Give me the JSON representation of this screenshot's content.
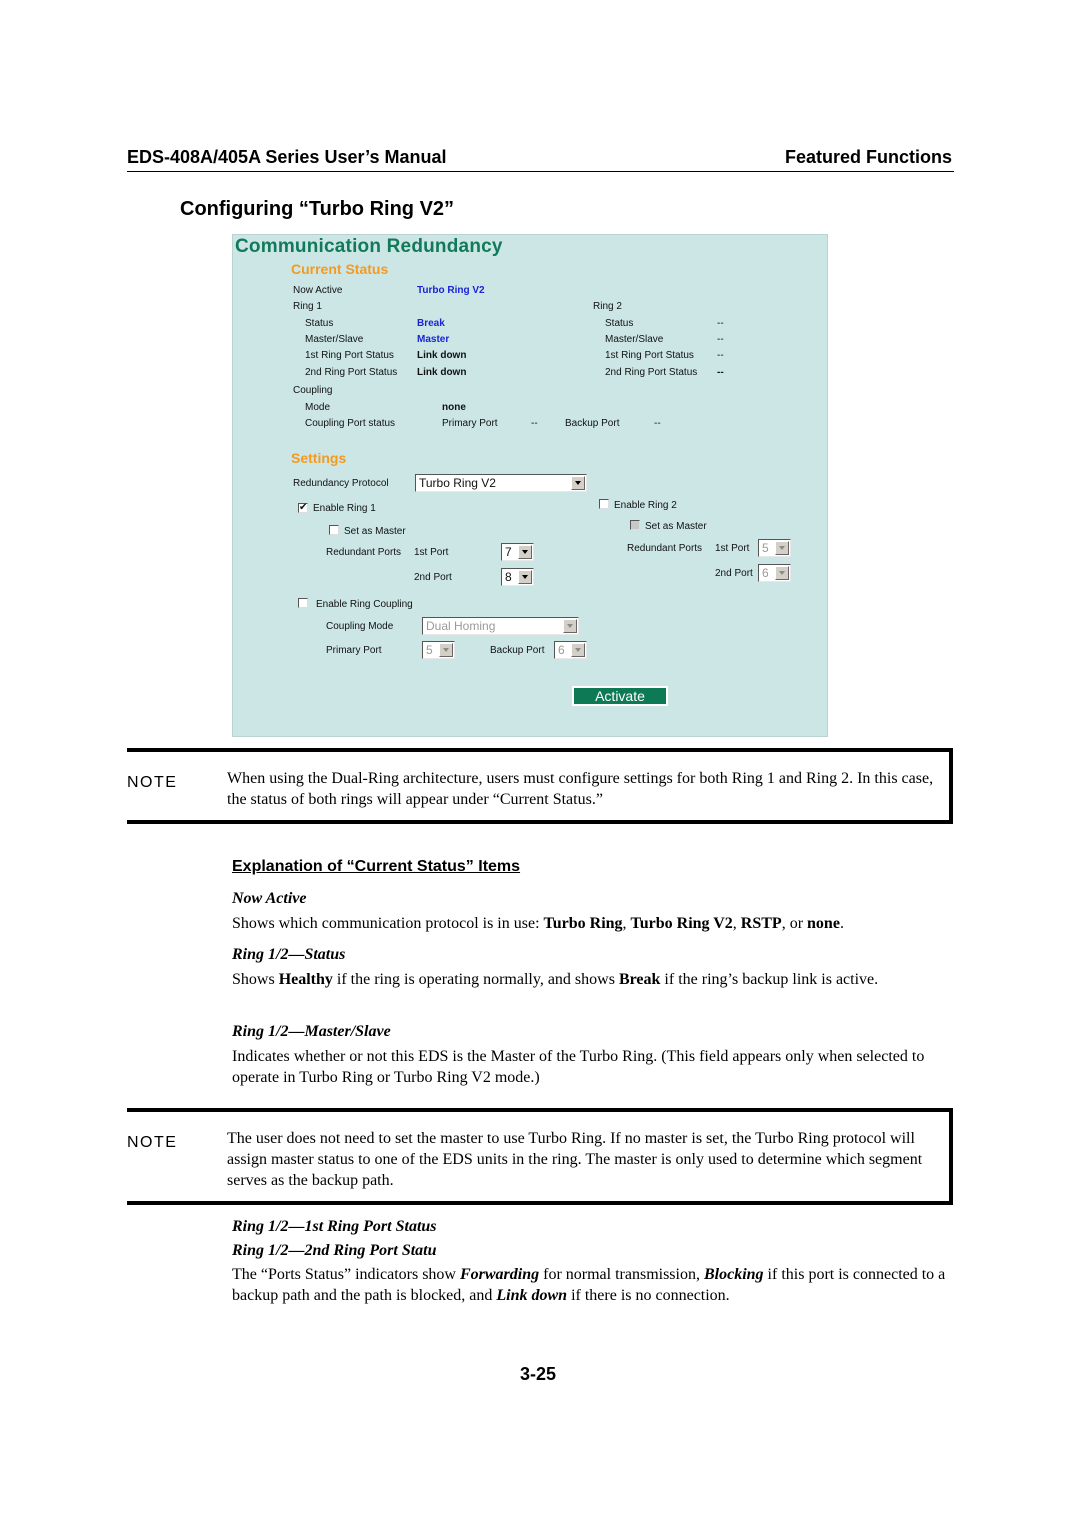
{
  "header": {
    "manual_title": "EDS-408A/405A Series User’s Manual",
    "chapter": "Featured Functions"
  },
  "section_title": "Configuring “Turbo Ring V2”",
  "panel": {
    "title": "Communication Redundancy",
    "current_status": {
      "heading": "Current Status",
      "now_active_label": "Now Active",
      "now_active_value": "Turbo Ring V2",
      "ring1": {
        "label": "Ring 1",
        "status_label": "Status",
        "status_value": "Break",
        "master_label": "Master/Slave",
        "master_value": "Master",
        "port1_label": "1st Ring Port Status",
        "port1_value": "Link down",
        "port2_label": "2nd Ring Port Status",
        "port2_value": "Link down"
      },
      "ring2": {
        "label": "Ring 2",
        "status_label": "Status",
        "status_value": "--",
        "master_label": "Master/Slave",
        "master_value": "--",
        "port1_label": "1st Ring Port Status",
        "port1_value": "--",
        "port2_label": "2nd Ring Port Status",
        "port2_value": "--"
      },
      "coupling": {
        "label": "Coupling",
        "mode_label": "Mode",
        "mode_value": "none",
        "port_status_label": "Coupling Port status",
        "primary_label": "Primary Port",
        "primary_value": "--",
        "backup_label": "Backup Port",
        "backup_value": "--"
      }
    },
    "settings": {
      "heading": "Settings",
      "protocol_label": "Redundancy Protocol",
      "protocol_value": "Turbo Ring V2",
      "ring1": {
        "enable_label": "Enable Ring 1",
        "enable_checked": "✔",
        "master_label": "Set as Master",
        "ports_label": "Redundant Ports",
        "port1_label": "1st Port",
        "port1_value": "7",
        "port2_label": "2nd Port",
        "port2_value": "8"
      },
      "ring2": {
        "enable_label": "Enable Ring 2",
        "master_label": "Set as Master",
        "ports_label": "Redundant Ports",
        "port1_label": "1st Port",
        "port1_value": "5",
        "port2_label": "2nd Port",
        "port2_value": "6"
      },
      "coupling": {
        "enable_label": "Enable Ring Coupling",
        "mode_label": "Coupling Mode",
        "mode_value": "Dual Homing",
        "primary_label": "Primary Port",
        "primary_value": "5",
        "backup_label": "Backup Port",
        "backup_value": "6"
      },
      "activate_label": "Activate"
    },
    "colors": {
      "background": "#cce6e6",
      "title": "#127a5a",
      "subheading": "#f59a1f",
      "value_blue": "#1a24d6",
      "button": "#0d7a55"
    }
  },
  "notes": [
    {
      "label": "NOTE",
      "text": "When using the Dual-Ring architecture, users must configure settings for both Ring 1 and Ring 2. In this case, the status of both rings will appear under “Current Status.”"
    },
    {
      "label": "NOTE",
      "text": "The user does not need to set the master to use Turbo Ring. If no master is set, the Turbo Ring protocol will assign master status to one of the EDS units in the ring. The master is only used to determine which segment serves as the backup path."
    }
  ],
  "explanation": {
    "heading": "Explanation of “Current Status” Items",
    "now_active": {
      "title": "Now Active",
      "t1": "Shows which communication protocol is in use: ",
      "b1": "Turbo Ring",
      "t2": ", ",
      "b2": "Turbo Ring V2",
      "t3": ", ",
      "b3": "RSTP",
      "t4": ", or ",
      "b4": "none",
      "t5": "."
    },
    "status": {
      "title": "Ring 1/2—Status",
      "t1": "Shows ",
      "b1": "Healthy",
      "t2": " if the ring is operating normally, and shows ",
      "b2": "Break",
      "t3": " if the ring’s backup link is active."
    },
    "master_slave": {
      "title": "Ring 1/2—Master/Slave",
      "text": "Indicates whether or not this EDS is the Master of the Turbo Ring. (This field appears only when selected to operate in Turbo Ring or Turbo Ring V2 mode.)"
    },
    "port_status": {
      "title1": "Ring 1/2—1st Ring Port Status",
      "title2": "Ring 1/2—2nd Ring Port Statu",
      "t1": "The “Ports Status” indicators show ",
      "b1": "Forwarding",
      "t2": " for normal transmission, ",
      "b2": "Blocking",
      "t3": " if this port is connected to a backup path and the path is blocked, and ",
      "b3": "Link down",
      "t4": " if there is no connection."
    }
  },
  "page_number": "3-25"
}
